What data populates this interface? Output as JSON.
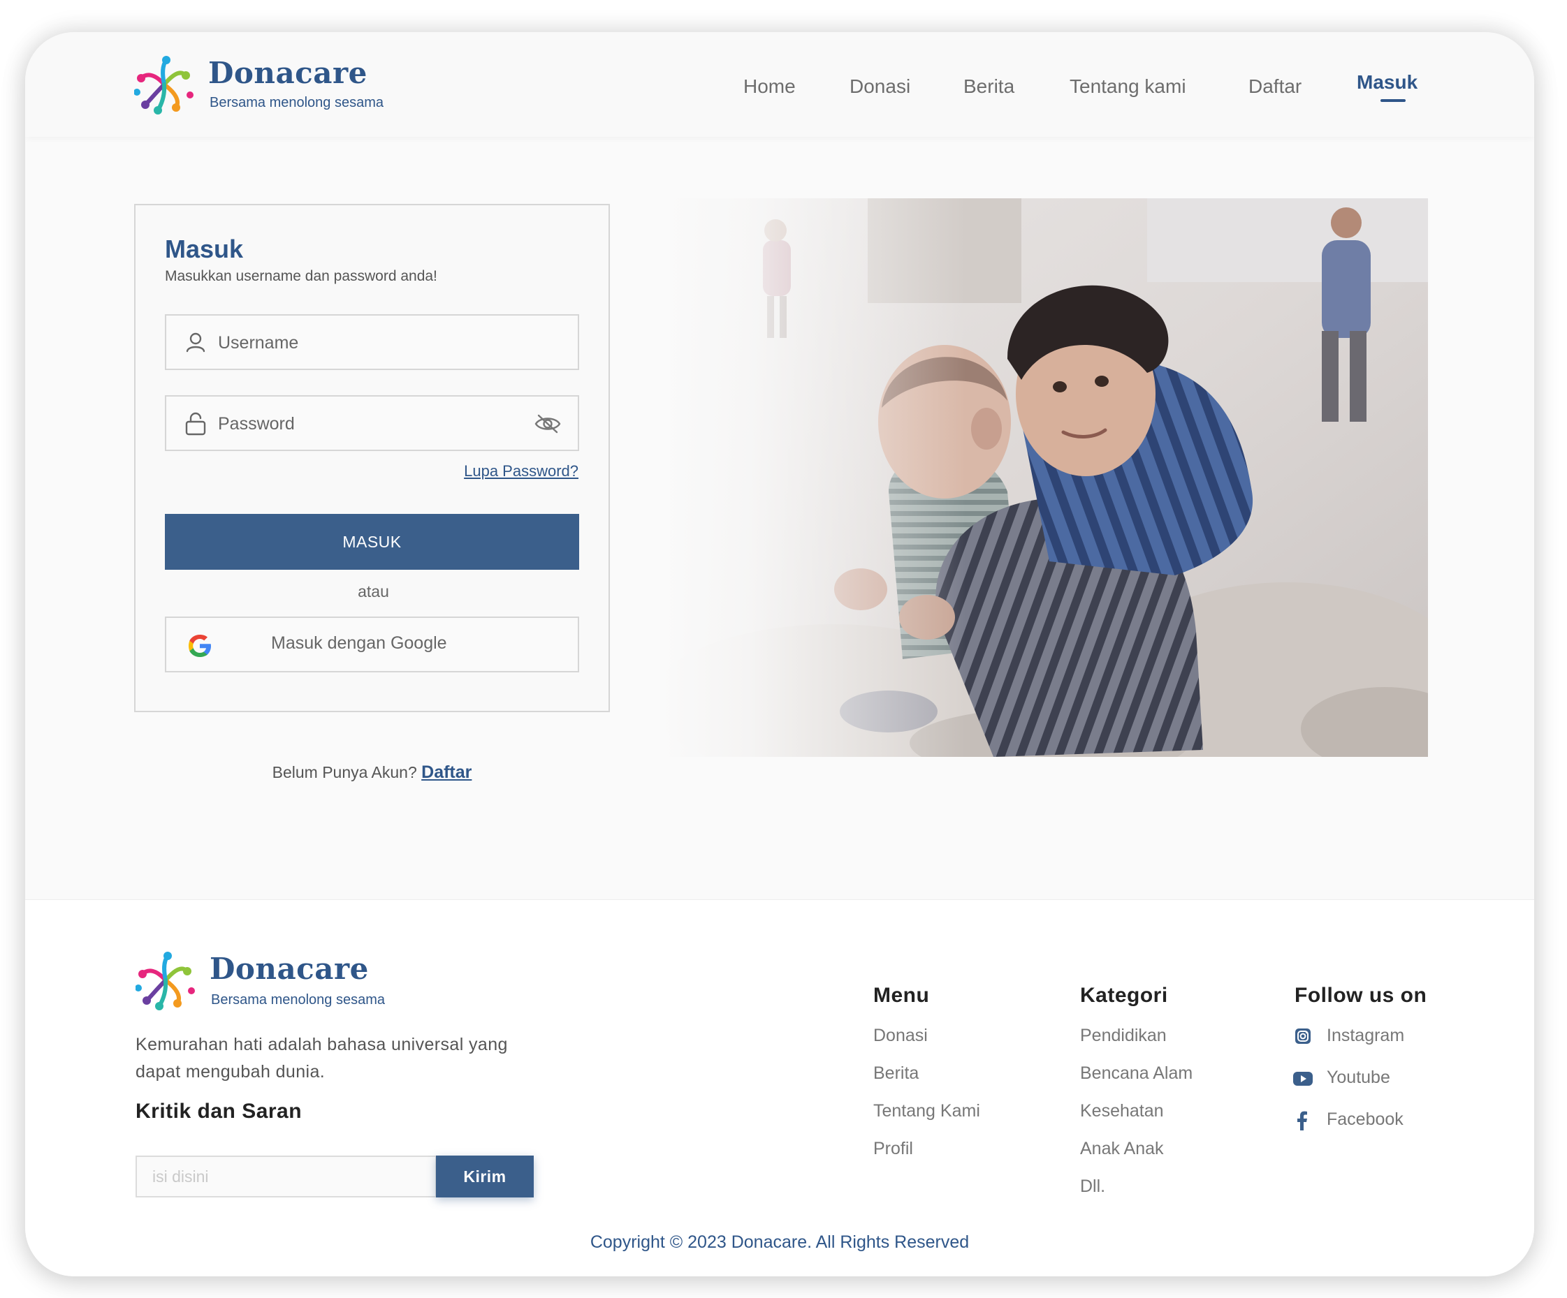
{
  "brand": {
    "name": "Donacare",
    "tagline": "Bersama menolong sesama"
  },
  "nav": {
    "items": [
      "Home",
      "Donasi",
      "Berita",
      "Tentang kami",
      "Daftar",
      "Masuk"
    ],
    "active": "Masuk"
  },
  "login": {
    "title": "Masuk",
    "subtitle": "Masukkan username dan password anda!",
    "username_placeholder": "Username",
    "password_placeholder": "Password",
    "forgot_label": "Lupa Password?",
    "submit_label": "MASUK",
    "or_label": "atau",
    "google_label": "Masuk dengan Google",
    "no_account_text": "Belum Punya Akun?",
    "register_link": "Daftar"
  },
  "footer": {
    "description": "Kemurahan hati adalah bahasa universal yang dapat mengubah dunia.",
    "feedback_title": "Kritik dan Saran",
    "feedback_placeholder": "isi disini",
    "feedback_button": "Kirim",
    "menu": {
      "title": "Menu",
      "items": [
        "Donasi",
        "Berita",
        "Tentang Kami",
        "Profil"
      ]
    },
    "kategori": {
      "title": "Kategori",
      "items": [
        "Pendidikan",
        "Bencana Alam",
        "Kesehatan",
        "Anak Anak",
        "Dll."
      ]
    },
    "follow": {
      "title": "Follow us on",
      "items": [
        {
          "label": "Instagram",
          "icon": "instagram-icon"
        },
        {
          "label": "Youtube",
          "icon": "youtube-icon"
        },
        {
          "label": "Facebook",
          "icon": "facebook-icon"
        }
      ]
    },
    "copyright": "Copyright © 2023 Donacare. All Rights Reserved"
  },
  "colors": {
    "primary": "#2f5689",
    "button": "#3b5f8b",
    "background": "#fafafa",
    "muted_text": "#6d6d6d"
  }
}
